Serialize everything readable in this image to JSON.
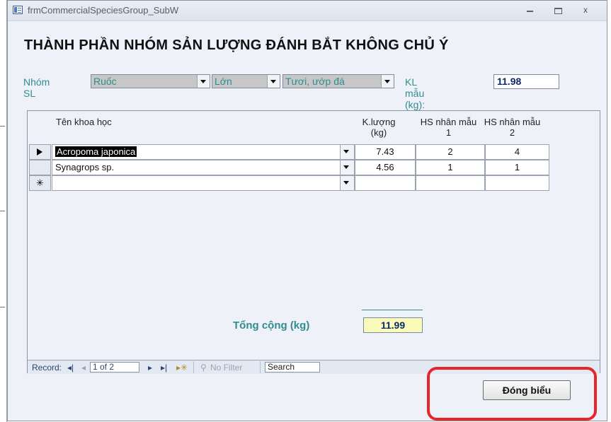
{
  "window": {
    "title": "frmCommercialSpeciesGroup_SubW",
    "controls": {
      "minimize": "",
      "maximize": "",
      "close": "x"
    }
  },
  "form": {
    "heading": "THÀNH PHẦN NHÓM SẢN LƯỢNG ĐÁNH BẮT KHÔNG CHỦ Ý",
    "filters": {
      "nhom_label": "Nhóm SL",
      "group": "Ruốc",
      "size": "Lớn",
      "condition": "Tươi, ướp đá",
      "kl_label": "KL mẫu (kg):",
      "kl_value": "11.98"
    },
    "grid": {
      "headers": {
        "name": "Tên khoa học",
        "weight": "K.lượng (kg)",
        "hs1": "HS nhân mẫu 1",
        "hs2": "HS nhân mẫu 2"
      },
      "rows": [
        {
          "name": "Acropoma japonica",
          "weight": "7.43",
          "hs1": "2",
          "hs2": "4"
        },
        {
          "name": "Synagrops sp.",
          "weight": "4.56",
          "hs1": "1",
          "hs2": "1"
        }
      ],
      "new_row_marker": "✳"
    },
    "total": {
      "label": "Tổng cộng (kg)",
      "value": "11.99"
    },
    "navigation": {
      "record_label": "Record:",
      "first": "◂|",
      "prev": "◂",
      "position": "1 of 2",
      "next": "▸",
      "last": "▸|",
      "new": "▸✳",
      "filter": "No Filter",
      "search": "Search"
    },
    "close_button": "Đóng biểu"
  },
  "colors": {
    "accent_teal": "#2f8d8f",
    "annotation_red": "#e8262a",
    "total_fill": "#fafabb"
  }
}
